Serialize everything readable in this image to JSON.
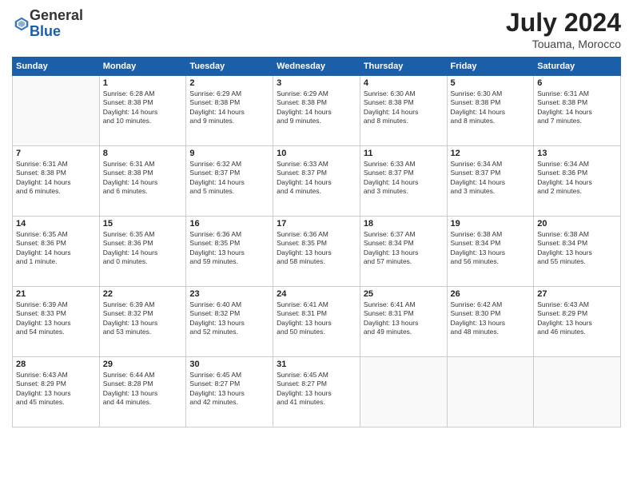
{
  "logo": {
    "general": "General",
    "blue": "Blue"
  },
  "header": {
    "month": "July 2024",
    "location": "Touama, Morocco"
  },
  "weekdays": [
    "Sunday",
    "Monday",
    "Tuesday",
    "Wednesday",
    "Thursday",
    "Friday",
    "Saturday"
  ],
  "weeks": [
    [
      {
        "day": "",
        "info": ""
      },
      {
        "day": "1",
        "info": "Sunrise: 6:28 AM\nSunset: 8:38 PM\nDaylight: 14 hours\nand 10 minutes."
      },
      {
        "day": "2",
        "info": "Sunrise: 6:29 AM\nSunset: 8:38 PM\nDaylight: 14 hours\nand 9 minutes."
      },
      {
        "day": "3",
        "info": "Sunrise: 6:29 AM\nSunset: 8:38 PM\nDaylight: 14 hours\nand 9 minutes."
      },
      {
        "day": "4",
        "info": "Sunrise: 6:30 AM\nSunset: 8:38 PM\nDaylight: 14 hours\nand 8 minutes."
      },
      {
        "day": "5",
        "info": "Sunrise: 6:30 AM\nSunset: 8:38 PM\nDaylight: 14 hours\nand 8 minutes."
      },
      {
        "day": "6",
        "info": "Sunrise: 6:31 AM\nSunset: 8:38 PM\nDaylight: 14 hours\nand 7 minutes."
      }
    ],
    [
      {
        "day": "7",
        "info": "Sunrise: 6:31 AM\nSunset: 8:38 PM\nDaylight: 14 hours\nand 6 minutes."
      },
      {
        "day": "8",
        "info": "Sunrise: 6:31 AM\nSunset: 8:38 PM\nDaylight: 14 hours\nand 6 minutes."
      },
      {
        "day": "9",
        "info": "Sunrise: 6:32 AM\nSunset: 8:37 PM\nDaylight: 14 hours\nand 5 minutes."
      },
      {
        "day": "10",
        "info": "Sunrise: 6:33 AM\nSunset: 8:37 PM\nDaylight: 14 hours\nand 4 minutes."
      },
      {
        "day": "11",
        "info": "Sunrise: 6:33 AM\nSunset: 8:37 PM\nDaylight: 14 hours\nand 3 minutes."
      },
      {
        "day": "12",
        "info": "Sunrise: 6:34 AM\nSunset: 8:37 PM\nDaylight: 14 hours\nand 3 minutes."
      },
      {
        "day": "13",
        "info": "Sunrise: 6:34 AM\nSunset: 8:36 PM\nDaylight: 14 hours\nand 2 minutes."
      }
    ],
    [
      {
        "day": "14",
        "info": "Sunrise: 6:35 AM\nSunset: 8:36 PM\nDaylight: 14 hours\nand 1 minute."
      },
      {
        "day": "15",
        "info": "Sunrise: 6:35 AM\nSunset: 8:36 PM\nDaylight: 14 hours\nand 0 minutes."
      },
      {
        "day": "16",
        "info": "Sunrise: 6:36 AM\nSunset: 8:35 PM\nDaylight: 13 hours\nand 59 minutes."
      },
      {
        "day": "17",
        "info": "Sunrise: 6:36 AM\nSunset: 8:35 PM\nDaylight: 13 hours\nand 58 minutes."
      },
      {
        "day": "18",
        "info": "Sunrise: 6:37 AM\nSunset: 8:34 PM\nDaylight: 13 hours\nand 57 minutes."
      },
      {
        "day": "19",
        "info": "Sunrise: 6:38 AM\nSunset: 8:34 PM\nDaylight: 13 hours\nand 56 minutes."
      },
      {
        "day": "20",
        "info": "Sunrise: 6:38 AM\nSunset: 8:34 PM\nDaylight: 13 hours\nand 55 minutes."
      }
    ],
    [
      {
        "day": "21",
        "info": "Sunrise: 6:39 AM\nSunset: 8:33 PM\nDaylight: 13 hours\nand 54 minutes."
      },
      {
        "day": "22",
        "info": "Sunrise: 6:39 AM\nSunset: 8:32 PM\nDaylight: 13 hours\nand 53 minutes."
      },
      {
        "day": "23",
        "info": "Sunrise: 6:40 AM\nSunset: 8:32 PM\nDaylight: 13 hours\nand 52 minutes."
      },
      {
        "day": "24",
        "info": "Sunrise: 6:41 AM\nSunset: 8:31 PM\nDaylight: 13 hours\nand 50 minutes."
      },
      {
        "day": "25",
        "info": "Sunrise: 6:41 AM\nSunset: 8:31 PM\nDaylight: 13 hours\nand 49 minutes."
      },
      {
        "day": "26",
        "info": "Sunrise: 6:42 AM\nSunset: 8:30 PM\nDaylight: 13 hours\nand 48 minutes."
      },
      {
        "day": "27",
        "info": "Sunrise: 6:43 AM\nSunset: 8:29 PM\nDaylight: 13 hours\nand 46 minutes."
      }
    ],
    [
      {
        "day": "28",
        "info": "Sunrise: 6:43 AM\nSunset: 8:29 PM\nDaylight: 13 hours\nand 45 minutes."
      },
      {
        "day": "29",
        "info": "Sunrise: 6:44 AM\nSunset: 8:28 PM\nDaylight: 13 hours\nand 44 minutes."
      },
      {
        "day": "30",
        "info": "Sunrise: 6:45 AM\nSunset: 8:27 PM\nDaylight: 13 hours\nand 42 minutes."
      },
      {
        "day": "31",
        "info": "Sunrise: 6:45 AM\nSunset: 8:27 PM\nDaylight: 13 hours\nand 41 minutes."
      },
      {
        "day": "",
        "info": ""
      },
      {
        "day": "",
        "info": ""
      },
      {
        "day": "",
        "info": ""
      }
    ]
  ]
}
